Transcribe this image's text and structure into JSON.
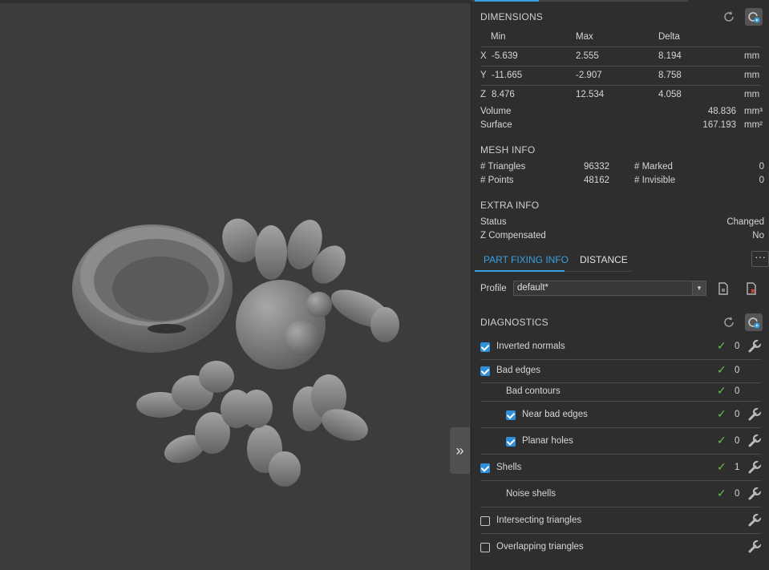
{
  "dimensions": {
    "title": "DIMENSIONS",
    "headers": {
      "min": "Min",
      "max": "Max",
      "delta": "Delta"
    },
    "rows": [
      {
        "axis": "X",
        "min": "-5.639",
        "max": "2.555",
        "delta": "8.194",
        "unit": "mm"
      },
      {
        "axis": "Y",
        "min": "-11.665",
        "max": "-2.907",
        "delta": "8.758",
        "unit": "mm"
      },
      {
        "axis": "Z",
        "min": "8.476",
        "max": "12.534",
        "delta": "4.058",
        "unit": "mm"
      }
    ],
    "volume_label": "Volume",
    "volume_value": "48.836",
    "volume_unit": "mm³",
    "surface_label": "Surface",
    "surface_value": "167.193",
    "surface_unit": "mm²"
  },
  "mesh_info": {
    "title": "MESH INFO",
    "triangles_label": "# Triangles",
    "triangles_value": "96332",
    "points_label": "# Points",
    "points_value": "48162",
    "marked_label": "# Marked",
    "marked_value": "0",
    "invisible_label": "# Invisible",
    "invisible_value": "0"
  },
  "extra_info": {
    "title": "EXTRA INFO",
    "status_label": "Status",
    "status_value": "Changed",
    "zcomp_label": "Z Compensated",
    "zcomp_value": "No"
  },
  "tabs": {
    "part_fixing": "PART FIXING INFO",
    "distance": "DISTANCE",
    "more": "···"
  },
  "profile": {
    "label": "Profile",
    "value": "default*"
  },
  "diagnostics": {
    "title": "DIAGNOSTICS",
    "items": [
      {
        "label": "Inverted normals",
        "checked": true,
        "count": "0",
        "status": "ok"
      },
      {
        "label": "Bad edges",
        "checked": true,
        "count": "0",
        "status": "ok"
      },
      {
        "label": "Bad contours",
        "checked": null,
        "count": "0",
        "status": "ok"
      },
      {
        "label": "Near bad edges",
        "checked": true,
        "count": "0",
        "status": "ok"
      },
      {
        "label": "Planar holes",
        "checked": true,
        "count": "0",
        "status": "ok"
      },
      {
        "label": "Shells",
        "checked": true,
        "count": "1",
        "status": "ok"
      },
      {
        "label": "Noise shells",
        "checked": null,
        "count": "0",
        "status": "ok"
      },
      {
        "label": "Intersecting triangles",
        "checked": false,
        "count": "",
        "status": ""
      },
      {
        "label": "Overlapping triangles",
        "checked": false,
        "count": "",
        "status": ""
      }
    ]
  },
  "viewport": {
    "collapse_glyph": "»"
  },
  "colors": {
    "accent": "#3aa0e0",
    "ok": "#6cc04a",
    "panel_bg": "#2e2e2e",
    "viewport_bg": "#3c3c3c"
  }
}
